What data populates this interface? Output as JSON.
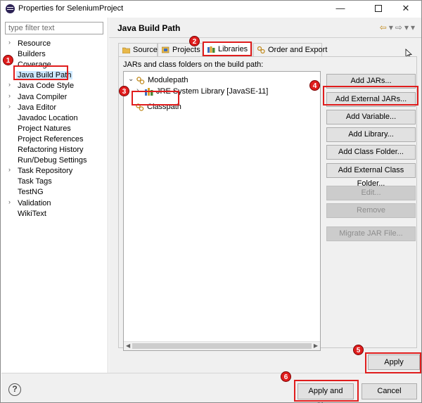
{
  "window": {
    "title": "Properties for SeleniumProject",
    "minimize": "—",
    "close": "✕"
  },
  "filter": {
    "placeholder": "type filter text"
  },
  "sidebar": {
    "items": [
      {
        "label": "Resource",
        "arrow": "›"
      },
      {
        "label": "Builders",
        "arrow": ""
      },
      {
        "label": "Coverage",
        "arrow": ""
      },
      {
        "label": "Java Build Path",
        "arrow": ""
      },
      {
        "label": "Java Code Style",
        "arrow": "›"
      },
      {
        "label": "Java Compiler",
        "arrow": "›"
      },
      {
        "label": "Java Editor",
        "arrow": "›"
      },
      {
        "label": "Javadoc Location",
        "arrow": ""
      },
      {
        "label": "Project Natures",
        "arrow": ""
      },
      {
        "label": "Project References",
        "arrow": ""
      },
      {
        "label": "Refactoring History",
        "arrow": ""
      },
      {
        "label": "Run/Debug Settings",
        "arrow": ""
      },
      {
        "label": "Task Repository",
        "arrow": "›"
      },
      {
        "label": "Task Tags",
        "arrow": ""
      },
      {
        "label": "TestNG",
        "arrow": ""
      },
      {
        "label": "Validation",
        "arrow": "›"
      },
      {
        "label": "WikiText",
        "arrow": ""
      }
    ],
    "selected": "Java Build Path"
  },
  "page": {
    "title": "Java Build Path"
  },
  "tabs": [
    {
      "label": "Source",
      "icon": "source-folder-icon"
    },
    {
      "label": "Projects",
      "icon": "projects-icon"
    },
    {
      "label": "Libraries",
      "icon": "libraries-icon"
    },
    {
      "label": "Order and Export",
      "icon": "order-export-icon"
    }
  ],
  "libraries": {
    "caption": "JARs and class folders on the build path:",
    "tree": {
      "modulepath": {
        "label": "Modulepath",
        "expand": "⌄"
      },
      "jre": {
        "label": "JRE System Library [JavaSE-11]",
        "expand": "›"
      },
      "classpath": {
        "label": "Classpath"
      }
    },
    "buttons": {
      "add_jars": "Add JARs...",
      "add_external_jars": "Add External JARs...",
      "add_variable": "Add Variable...",
      "add_library": "Add Library...",
      "add_class_folder": "Add Class Folder...",
      "add_external_class_folder": "Add External Class Folder...",
      "edit": "Edit...",
      "remove": "Remove",
      "migrate_jar": "Migrate JAR File..."
    }
  },
  "footer": {
    "apply": "Apply",
    "apply_and_close": "Apply and Close",
    "cancel": "Cancel",
    "help": "?"
  },
  "annotations": [
    "1",
    "2",
    "3",
    "4",
    "5",
    "6"
  ],
  "colors": {
    "highlight": "#e01d1d",
    "selection": "#cce8ff",
    "nav_arrow": "#c08a1e"
  }
}
